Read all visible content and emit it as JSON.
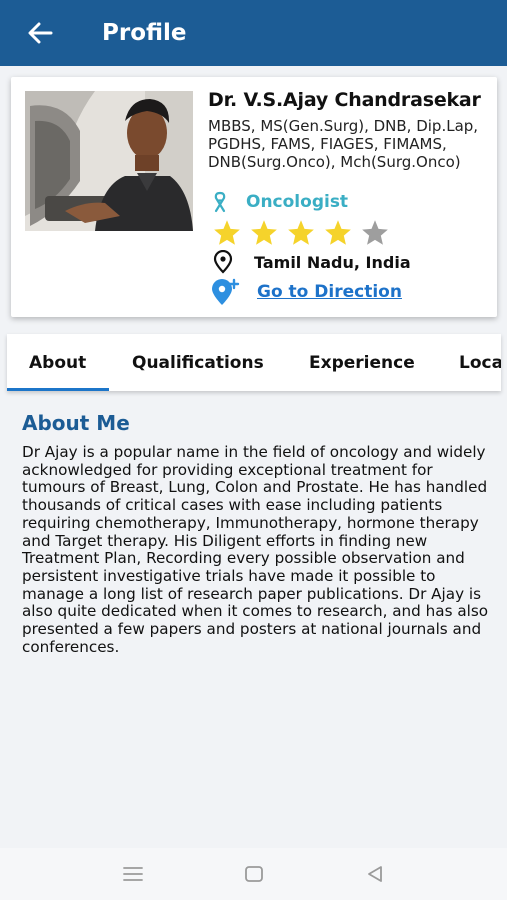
{
  "appbar": {
    "title": "Profile",
    "back_icon": "arrow-left-icon"
  },
  "doctor": {
    "name": "Dr. V.S.Ajay Chandrasekar",
    "degrees": "MBBS, MS(Gen.Surg), DNB, Dip.Lap, PGDHS, FAMS, FIAGES, FIMAMS, DNB(Surg.Onco), Mch(Surg.Onco)",
    "specialty": "Oncologist",
    "rating": 4,
    "rating_max": 5,
    "location": "Tamil Nadu, India",
    "direction_link": "Go to Direction"
  },
  "tabs": [
    {
      "label": "About",
      "active": true
    },
    {
      "label": "Qualifications",
      "active": false
    },
    {
      "label": "Experience",
      "active": false
    },
    {
      "label": "Loca",
      "active": false
    }
  ],
  "about": {
    "title": "About Me",
    "body": "Dr Ajay is a popular name in the field of oncology and widely acknowledged for providing exceptional treatment for tumours of Breast, Lung, Colon and Prostate. He has handled thousands of critical cases with ease including patients requiring chemotherapy, Immunotherapy, hormone therapy and Target therapy. His Diligent efforts in finding new Treatment Plan, Recording every possible observation and persistent investigative trials have made it possible to manage a long list of research paper publications. Dr Ajay is also quite dedicated when it comes to research, and has also presented a few papers and posters at national journals and conferences."
  },
  "colors": {
    "appbar": "#1c5c95",
    "specialty": "#3aaec4",
    "star_filled": "#f5d32b",
    "star_empty": "#9e9e9e",
    "link": "#1d72c9"
  },
  "navbar": {
    "icons": [
      "menu-icon",
      "home-square-icon",
      "back-triangle-icon"
    ]
  }
}
